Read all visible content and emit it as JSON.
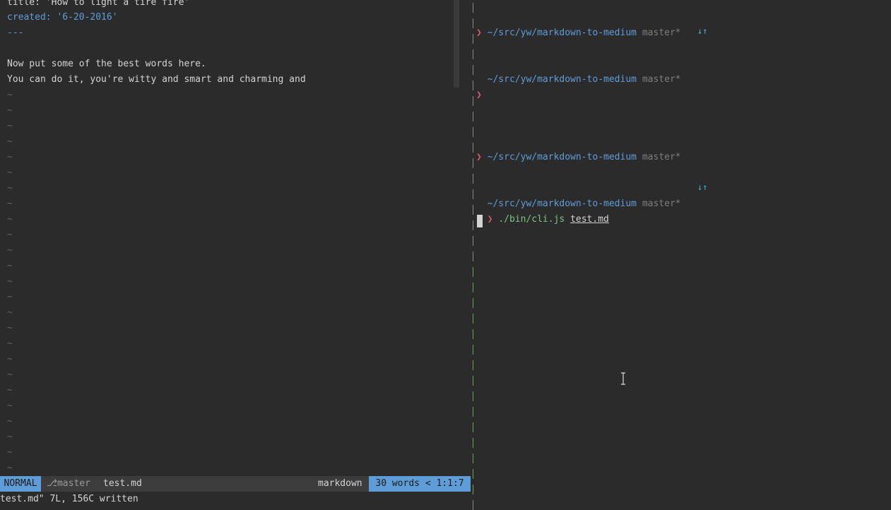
{
  "editor": {
    "lines": [
      {
        "text": "title: 'How to light a tire fire'",
        "cls": "fm-key"
      },
      {
        "text": "created: '6-20-2016'",
        "cls": "fm-blue"
      },
      {
        "text": "---",
        "cls": "fm-blue"
      },
      {
        "text": "",
        "cls": ""
      },
      {
        "text": "Now put some of the best words here.",
        "cls": ""
      },
      {
        "text": "You can do it, you're witty and smart and charming and",
        "cls": ""
      }
    ],
    "tilde": "~"
  },
  "statusline": {
    "mode": "NORMAL",
    "branch_icon": "⎇",
    "branch": "master",
    "filename": "test.md",
    "filetype": "markdown",
    "word_count": "30 words < 1:1:7"
  },
  "cmdline": {
    "message": "test.md\" 7L, 156C written"
  },
  "terminal": {
    "path": "~/src/yw/markdown-to-medium",
    "git_branch": "master*",
    "prompt_symbol": "❯",
    "arrows_icon": "↓↑",
    "command_bin": "./bin/cli.js",
    "command_arg": "test.md"
  },
  "colors": {
    "accent": "#5f9dd8",
    "prompt": "#e0566b",
    "background": "#2b2b2b"
  }
}
